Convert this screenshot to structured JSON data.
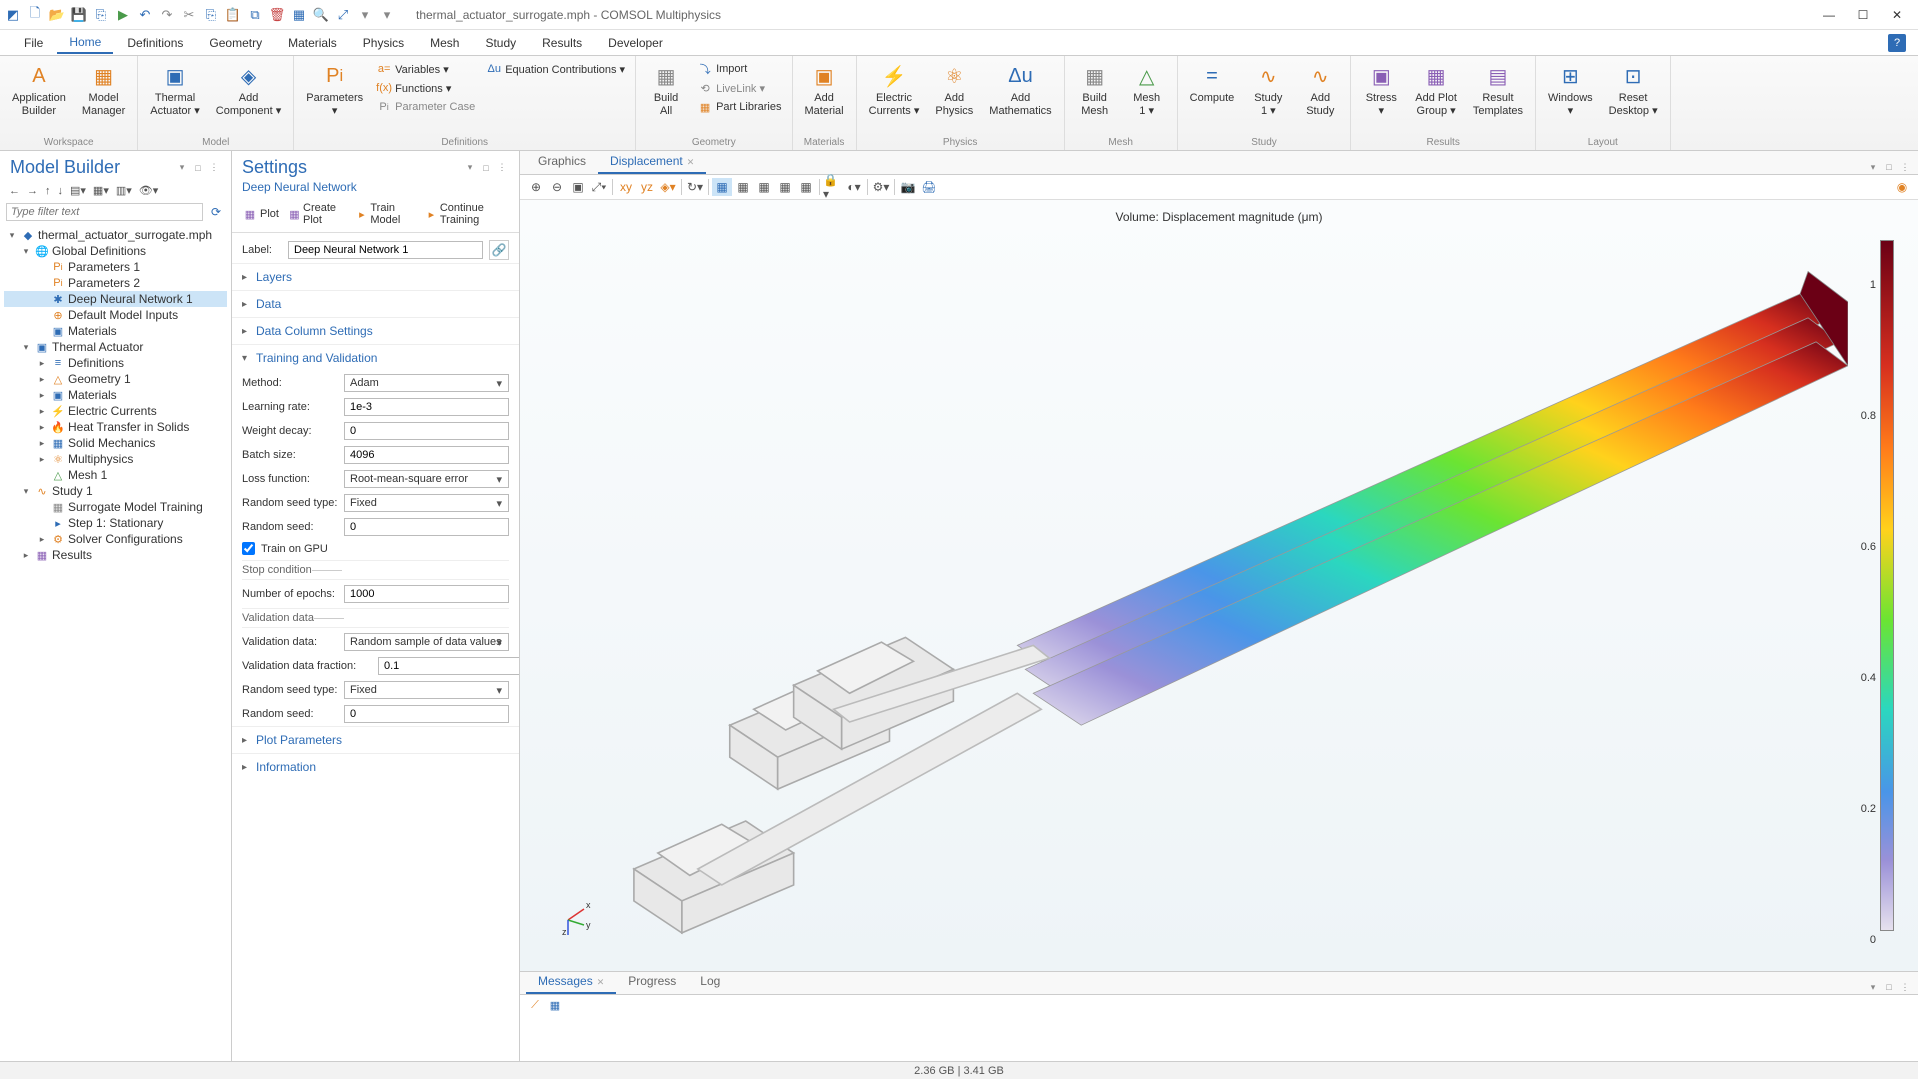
{
  "window": {
    "title": "thermal_actuator_surrogate.mph - COMSOL Multiphysics"
  },
  "menubar": {
    "items": [
      "File",
      "Home",
      "Definitions",
      "Geometry",
      "Materials",
      "Physics",
      "Mesh",
      "Study",
      "Results",
      "Developer"
    ],
    "active": "Home"
  },
  "ribbon": {
    "workspace": {
      "label": "Workspace",
      "app_builder": "Application\nBuilder",
      "model_manager": "Model\nManager"
    },
    "model": {
      "label": "Model",
      "thermal_actuator": "Thermal\nActuator ▾",
      "add_component": "Add\nComponent ▾"
    },
    "definitions": {
      "label": "Definitions",
      "parameters": "Parameters\n▾",
      "variables": "Variables ▾",
      "functions": "Functions ▾",
      "parameter_case": "Parameter Case",
      "eq_contrib": "Equation Contributions ▾"
    },
    "geometry": {
      "label": "Geometry",
      "build_all": "Build\nAll",
      "import": "Import",
      "livelink": "LiveLink ▾",
      "part_libs": "Part Libraries"
    },
    "materials": {
      "label": "Materials",
      "add_material": "Add\nMaterial"
    },
    "physics": {
      "label": "Physics",
      "electric": "Electric\nCurrents ▾",
      "add_physics": "Add\nPhysics",
      "add_math": "Add\nMathematics"
    },
    "mesh": {
      "label": "Mesh",
      "build_mesh": "Build\nMesh",
      "mesh1": "Mesh\n1 ▾"
    },
    "study": {
      "label": "Study",
      "compute": "Compute",
      "study1": "Study\n1 ▾",
      "add_study": "Add\nStudy"
    },
    "results": {
      "label": "Results",
      "stress": "Stress\n▾",
      "add_plot": "Add Plot\nGroup ▾",
      "templates": "Result\nTemplates"
    },
    "layout": {
      "label": "Layout",
      "windows": "Windows\n▾",
      "reset": "Reset\nDesktop ▾"
    }
  },
  "model_builder": {
    "title": "Model Builder",
    "filter_placeholder": "Type filter text",
    "tree": {
      "root": "thermal_actuator_surrogate.mph",
      "global_defs": "Global Definitions",
      "params1": "Parameters 1",
      "params2": "Parameters 2",
      "dnn1": "Deep Neural Network 1",
      "default_inputs": "Default Model Inputs",
      "materials": "Materials",
      "component": "Thermal Actuator",
      "definitions": "Definitions",
      "geometry": "Geometry 1",
      "comp_materials": "Materials",
      "ec": "Electric Currents",
      "ht": "Heat Transfer in Solids",
      "solid": "Solid Mechanics",
      "multiphysics": "Multiphysics",
      "mesh": "Mesh 1",
      "study": "Study 1",
      "surrogate": "Surrogate Model Training",
      "step1": "Step 1: Stationary",
      "solver": "Solver Configurations",
      "results": "Results"
    }
  },
  "settings": {
    "title": "Settings",
    "subtitle": "Deep Neural Network",
    "toolbar": {
      "plot": "Plot",
      "create_plot": "Create Plot",
      "train": "Train Model",
      "continue": "Continue Training"
    },
    "label_label": "Label:",
    "label_value": "Deep Neural Network 1",
    "sections": {
      "layers": "Layers",
      "data": "Data",
      "data_columns": "Data Column Settings",
      "training": "Training and Validation",
      "plot_params": "Plot Parameters",
      "information": "Information"
    },
    "training": {
      "method_label": "Method:",
      "method_value": "Adam",
      "lr_label": "Learning rate:",
      "lr_value": "1e-3",
      "wd_label": "Weight decay:",
      "wd_value": "0",
      "batch_label": "Batch size:",
      "batch_value": "4096",
      "loss_label": "Loss function:",
      "loss_value": "Root-mean-square error",
      "seed_type_label": "Random seed type:",
      "seed_type_value": "Fixed",
      "seed_label": "Random seed:",
      "seed_value": "0",
      "gpu_label": "Train on GPU",
      "stop_cond": "Stop condition",
      "epochs_label": "Number of epochs:",
      "epochs_value": "1000",
      "validation_sub": "Validation data",
      "vdata_label": "Validation data:",
      "vdata_value": "Random sample of data values",
      "vfrac_label": "Validation data fraction:",
      "vfrac_value": "0.1",
      "vseed_type_label": "Random seed type:",
      "vseed_type_value": "Fixed",
      "vseed_label": "Random seed:",
      "vseed_value": "0"
    }
  },
  "graphics": {
    "tabs": {
      "graphics": "Graphics",
      "displacement": "Displacement"
    },
    "plot_title": "Volume: Displacement magnitude (μm)",
    "colorbar_ticks": [
      "1",
      "0.8",
      "0.6",
      "0.4",
      "0.2",
      "0"
    ],
    "axis": {
      "x": "x",
      "y": "y",
      "z": "z"
    }
  },
  "bottom": {
    "tabs": {
      "messages": "Messages",
      "progress": "Progress",
      "log": "Log"
    }
  },
  "statusbar": {
    "memory": "2.36 GB | 3.41 GB"
  }
}
